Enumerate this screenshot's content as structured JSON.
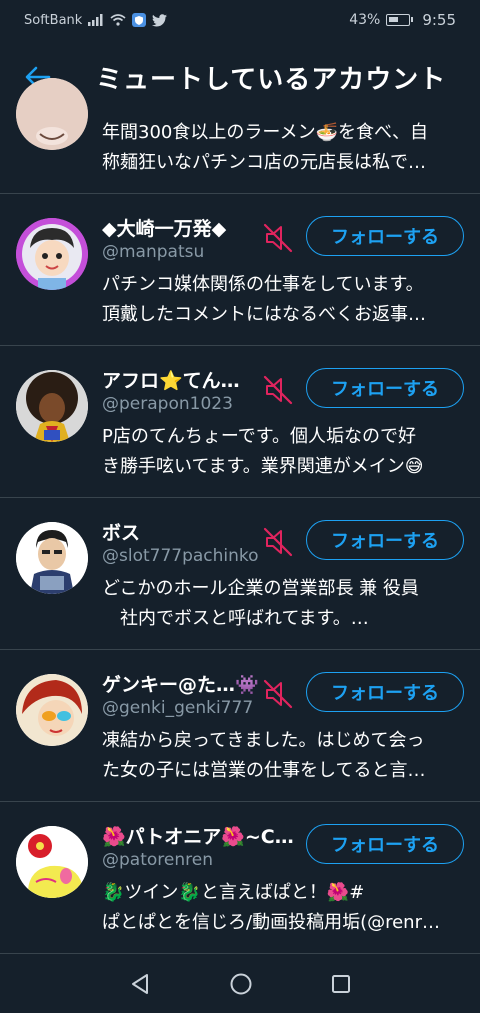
{
  "status_bar": {
    "carrier": "SoftBank",
    "battery": "43%",
    "time": "9:55",
    "icons": [
      "signal-icon",
      "wifi-icon",
      "shield-app-icon",
      "twitter-bird-icon",
      "battery-icon"
    ]
  },
  "header": {
    "title": "ミュートしているアカウント",
    "back_icon": "arrow-left-icon"
  },
  "accounts": [
    {
      "name": "",
      "handle": "",
      "bio": [
        "年間300食以上のラーメン🍜を食べ、自",
        "称麺狂いなパチンコ店の元店長は私で…"
      ]
    },
    {
      "name": "◆大崎一万発◆",
      "handle": "@manpatsu",
      "bio": [
        "パチンコ媒体関係の仕事をしています。",
        "頂戴したコメントにはなるべくお返事…"
      ],
      "follow_label": "フォローする",
      "mute_icon": "muted-speaker-icon"
    },
    {
      "name": "アフロ⭐てん…",
      "handle": "@perapon1023",
      "bio": [
        "P店のてんちょーです。個人垢なので好",
        "き勝手呟いてます。業界関連がメイン😅"
      ],
      "follow_label": "フォローする",
      "mute_icon": "muted-speaker-icon"
    },
    {
      "name": "ボス",
      "handle": "@slot777pachinko",
      "bio": [
        "どこかのホール企業の営業部長 兼 役員",
        "　社内でボスと呼ばれてます。…"
      ],
      "follow_label": "フォローする",
      "mute_icon": "muted-speaker-icon"
    },
    {
      "name": "ゲンキー@た…👾",
      "handle": "@genki_genki777",
      "bio": [
        "凍結から戻ってきました。はじめて会っ",
        "た女の子には営業の仕事をしてると言…"
      ],
      "follow_label": "フォローする",
      "mute_icon": "muted-speaker-icon"
    },
    {
      "name": "🌺パトオニア🌺~Co…",
      "handle": "@patorenren",
      "bio": [
        "🐉ツイン🐉と言えばぱと！🌺#",
        "ぱとぱとを信じろ/動画投稿用垢(@renr…"
      ],
      "follow_label": "フォローする",
      "mute_icon": "muted-speaker-icon"
    }
  ],
  "nav_bar": {
    "icons": [
      "back-triangle-icon",
      "home-circle-icon",
      "recents-square-icon"
    ]
  },
  "colors": {
    "background": "#15202b",
    "accent": "#1da1f2",
    "mute": "#e0245e",
    "secondary_text": "#8899a6",
    "divider": "#38444d"
  }
}
